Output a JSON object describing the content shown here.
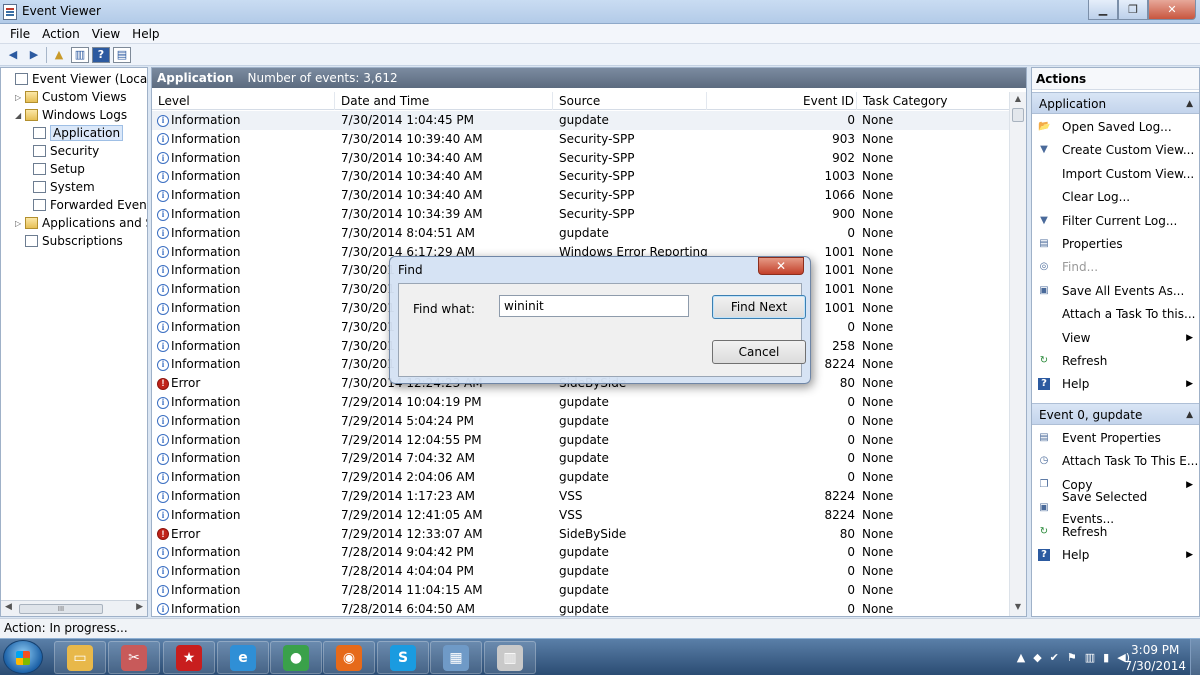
{
  "window": {
    "title": "Event Viewer"
  },
  "menu": [
    "File",
    "Action",
    "View",
    "Help"
  ],
  "tree": {
    "items": [
      {
        "label": "Event Viewer (Local)",
        "indent": 0,
        "arrow": "",
        "icon": "log"
      },
      {
        "label": "Custom Views",
        "indent": 1,
        "arrow": "▷",
        "icon": "folder"
      },
      {
        "label": "Windows Logs",
        "indent": 1,
        "arrow": "◢",
        "icon": "folder"
      },
      {
        "label": "Application",
        "indent": 2,
        "arrow": "",
        "icon": "log",
        "selected": true
      },
      {
        "label": "Security",
        "indent": 2,
        "arrow": "",
        "icon": "log"
      },
      {
        "label": "Setup",
        "indent": 2,
        "arrow": "",
        "icon": "log"
      },
      {
        "label": "System",
        "indent": 2,
        "arrow": "",
        "icon": "log"
      },
      {
        "label": "Forwarded Events",
        "indent": 2,
        "arrow": "",
        "icon": "log"
      },
      {
        "label": "Applications and Serv",
        "indent": 1,
        "arrow": "▷",
        "icon": "folder"
      },
      {
        "label": "Subscriptions",
        "indent": 1,
        "arrow": "",
        "icon": "log"
      }
    ]
  },
  "center": {
    "title": "Application",
    "count": "Number of events: 3,612",
    "columns": {
      "level": "Level",
      "date": "Date and Time",
      "source": "Source",
      "eid": "Event ID",
      "cat": "Task Category"
    },
    "rows": [
      {
        "level": "Information",
        "type": "info",
        "date": "7/30/2014 1:04:45 PM",
        "source": "gupdate",
        "eid": "0",
        "cat": "None"
      },
      {
        "level": "Information",
        "type": "info",
        "date": "7/30/2014 10:39:40 AM",
        "source": "Security-SPP",
        "eid": "903",
        "cat": "None"
      },
      {
        "level": "Information",
        "type": "info",
        "date": "7/30/2014 10:34:40 AM",
        "source": "Security-SPP",
        "eid": "902",
        "cat": "None"
      },
      {
        "level": "Information",
        "type": "info",
        "date": "7/30/2014 10:34:40 AM",
        "source": "Security-SPP",
        "eid": "1003",
        "cat": "None"
      },
      {
        "level": "Information",
        "type": "info",
        "date": "7/30/2014 10:34:40 AM",
        "source": "Security-SPP",
        "eid": "1066",
        "cat": "None"
      },
      {
        "level": "Information",
        "type": "info",
        "date": "7/30/2014 10:34:39 AM",
        "source": "Security-SPP",
        "eid": "900",
        "cat": "None"
      },
      {
        "level": "Information",
        "type": "info",
        "date": "7/30/2014 8:04:51 AM",
        "source": "gupdate",
        "eid": "0",
        "cat": "None"
      },
      {
        "level": "Information",
        "type": "info",
        "date": "7/30/2014 6:17:29 AM",
        "source": "Windows Error Reporting",
        "eid": "1001",
        "cat": "None"
      },
      {
        "level": "Information",
        "type": "info",
        "date": "7/30/201",
        "source": "",
        "eid": "1001",
        "cat": "None"
      },
      {
        "level": "Information",
        "type": "info",
        "date": "7/30/201",
        "source": "",
        "eid": "1001",
        "cat": "None"
      },
      {
        "level": "Information",
        "type": "info",
        "date": "7/30/201",
        "source": "",
        "eid": "1001",
        "cat": "None"
      },
      {
        "level": "Information",
        "type": "info",
        "date": "7/30/201",
        "source": "",
        "eid": "0",
        "cat": "None"
      },
      {
        "level": "Information",
        "type": "info",
        "date": "7/30/201",
        "source": "",
        "eid": "258",
        "cat": "None"
      },
      {
        "level": "Information",
        "type": "info",
        "date": "7/30/201",
        "source": "",
        "eid": "8224",
        "cat": "None"
      },
      {
        "level": "Error",
        "type": "error",
        "date": "7/30/2014 12:24:23 AM",
        "source": "SideBySide",
        "eid": "80",
        "cat": "None"
      },
      {
        "level": "Information",
        "type": "info",
        "date": "7/29/2014 10:04:19 PM",
        "source": "gupdate",
        "eid": "0",
        "cat": "None"
      },
      {
        "level": "Information",
        "type": "info",
        "date": "7/29/2014 5:04:24 PM",
        "source": "gupdate",
        "eid": "0",
        "cat": "None"
      },
      {
        "level": "Information",
        "type": "info",
        "date": "7/29/2014 12:04:55 PM",
        "source": "gupdate",
        "eid": "0",
        "cat": "None"
      },
      {
        "level": "Information",
        "type": "info",
        "date": "7/29/2014 7:04:32 AM",
        "source": "gupdate",
        "eid": "0",
        "cat": "None"
      },
      {
        "level": "Information",
        "type": "info",
        "date": "7/29/2014 2:04:06 AM",
        "source": "gupdate",
        "eid": "0",
        "cat": "None"
      },
      {
        "level": "Information",
        "type": "info",
        "date": "7/29/2014 1:17:23 AM",
        "source": "VSS",
        "eid": "8224",
        "cat": "None"
      },
      {
        "level": "Information",
        "type": "info",
        "date": "7/29/2014 12:41:05 AM",
        "source": "VSS",
        "eid": "8224",
        "cat": "None"
      },
      {
        "level": "Error",
        "type": "error",
        "date": "7/29/2014 12:33:07 AM",
        "source": "SideBySide",
        "eid": "80",
        "cat": "None"
      },
      {
        "level": "Information",
        "type": "info",
        "date": "7/28/2014 9:04:42 PM",
        "source": "gupdate",
        "eid": "0",
        "cat": "None"
      },
      {
        "level": "Information",
        "type": "info",
        "date": "7/28/2014 4:04:04 PM",
        "source": "gupdate",
        "eid": "0",
        "cat": "None"
      },
      {
        "level": "Information",
        "type": "info",
        "date": "7/28/2014 11:04:15 AM",
        "source": "gupdate",
        "eid": "0",
        "cat": "None"
      },
      {
        "level": "Information",
        "type": "info",
        "date": "7/28/2014 6:04:50 AM",
        "source": "gupdate",
        "eid": "0",
        "cat": "None"
      }
    ]
  },
  "actions": {
    "title": "Actions",
    "section1": "Application",
    "items1": [
      {
        "label": "Open Saved Log...",
        "icon": "folder-open-icon",
        "glyph": "📂"
      },
      {
        "label": "Create Custom View...",
        "icon": "filter-icon",
        "glyph": "▼"
      },
      {
        "label": "Import Custom View...",
        "icon": "",
        "glyph": ""
      },
      {
        "label": "Clear Log...",
        "icon": "",
        "glyph": ""
      },
      {
        "label": "Filter Current Log...",
        "icon": "filter-icon",
        "glyph": "▼"
      },
      {
        "label": "Properties",
        "icon": "properties-icon",
        "glyph": "▤"
      },
      {
        "label": "Find...",
        "icon": "find-icon",
        "glyph": "◎",
        "disabled": true
      },
      {
        "label": "Save All Events As...",
        "icon": "save-icon",
        "glyph": "▣"
      },
      {
        "label": "Attach a Task To this...",
        "icon": "",
        "glyph": ""
      },
      {
        "label": "View",
        "icon": "",
        "glyph": "",
        "submenu": true
      },
      {
        "label": "Refresh",
        "icon": "refresh-icon",
        "glyph": "↻"
      },
      {
        "label": "Help",
        "icon": "help-icon",
        "glyph": "?",
        "submenu": true
      }
    ],
    "section2": "Event 0, gupdate",
    "items2": [
      {
        "label": "Event Properties",
        "icon": "properties-icon",
        "glyph": "▤"
      },
      {
        "label": "Attach Task To This E...",
        "icon": "task-icon",
        "glyph": "◷"
      },
      {
        "label": "Copy",
        "icon": "copy-icon",
        "glyph": "❐",
        "submenu": true
      },
      {
        "label": "Save Selected Events...",
        "icon": "save-icon",
        "glyph": "▣"
      },
      {
        "label": "Refresh",
        "icon": "refresh-icon",
        "glyph": "↻"
      },
      {
        "label": "Help",
        "icon": "help-icon",
        "glyph": "?",
        "submenu": true
      }
    ]
  },
  "status": {
    "text": "Action:  In progress..."
  },
  "dialog": {
    "title": "Find",
    "close": "✕",
    "find_label": "Find what:",
    "find_value": "wininit",
    "find_next": "Find Next",
    "cancel": "Cancel"
  },
  "taskbar": {
    "apps": [
      {
        "name": "explorer-taskbar-icon",
        "glyph": "▭",
        "color": "#e8b84a"
      },
      {
        "name": "snipping-tool-taskbar-icon",
        "glyph": "✂",
        "color": "#c85a5a"
      },
      {
        "name": "pokerstars-taskbar-icon",
        "glyph": "★",
        "color": "#c81e1e"
      },
      {
        "name": "internet-explorer-taskbar-icon",
        "glyph": "e",
        "color": "#2f8fd6"
      },
      {
        "name": "chrome-taskbar-icon",
        "glyph": "●",
        "color": "#3aa14a"
      },
      {
        "name": "firefox-taskbar-icon",
        "glyph": "◉",
        "color": "#e66a1a"
      },
      {
        "name": "skype-taskbar-icon",
        "glyph": "S",
        "color": "#1a9be0"
      },
      {
        "name": "control-panel-taskbar-icon",
        "glyph": "▦",
        "color": "#6f9ac7"
      },
      {
        "name": "event-viewer-taskbar-icon",
        "glyph": "▥",
        "color": "#c9c9c9"
      }
    ],
    "time": "3:09 PM",
    "date": "7/30/2014"
  }
}
